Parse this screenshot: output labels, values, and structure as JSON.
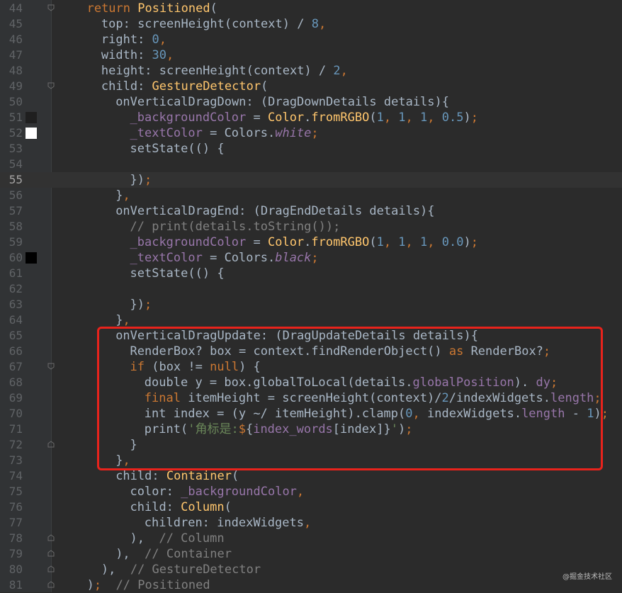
{
  "editor": {
    "first_line": 44,
    "current_line": 55,
    "colors": {
      "background": "#2b2b2b",
      "keyword": "#cc7832",
      "class": "#ffc66d",
      "number": "#6897bb",
      "comment": "#808080",
      "string": "#6a8759",
      "property": "#9876aa",
      "highlight_box": "#e8231c"
    },
    "lines": [
      {
        "n": "44",
        "indent": 2,
        "fold": "top",
        "tokens": [
          [
            "kw",
            "return "
          ],
          [
            "cls",
            "Positioned"
          ],
          [
            "pl",
            "("
          ]
        ]
      },
      {
        "n": "45",
        "indent": 3,
        "tokens": [
          [
            "pl",
            "top: screenHeight(context) / "
          ],
          [
            "num",
            "8"
          ],
          [
            "kw",
            ","
          ]
        ]
      },
      {
        "n": "46",
        "indent": 3,
        "tokens": [
          [
            "pl",
            "right: "
          ],
          [
            "num",
            "0"
          ],
          [
            "kw",
            ","
          ]
        ]
      },
      {
        "n": "47",
        "indent": 3,
        "tokens": [
          [
            "pl",
            "width: "
          ],
          [
            "num",
            "30"
          ],
          [
            "kw",
            ","
          ]
        ]
      },
      {
        "n": "48",
        "indent": 3,
        "tokens": [
          [
            "pl",
            "height: screenHeight(context) / "
          ],
          [
            "num",
            "2"
          ],
          [
            "kw",
            ","
          ]
        ]
      },
      {
        "n": "49",
        "indent": 3,
        "fold": "top",
        "tokens": [
          [
            "pl",
            "child: "
          ],
          [
            "cls",
            "GestureDetector"
          ],
          [
            "pl",
            "("
          ]
        ]
      },
      {
        "n": "50",
        "indent": 4,
        "tokens": [
          [
            "pl",
            "onVerticalDragDown: (DragDownDetails details){"
          ]
        ]
      },
      {
        "n": "51",
        "indent": 5,
        "swatch": "#1f1f1f",
        "tokens": [
          [
            "prop",
            "_backgroundColor"
          ],
          [
            "pl",
            " = "
          ],
          [
            "cls",
            "Color"
          ],
          [
            "pl",
            "."
          ],
          [
            "cls",
            "fromRGBO"
          ],
          [
            "pl",
            "("
          ],
          [
            "num",
            "1"
          ],
          [
            "kw",
            ", "
          ],
          [
            "num",
            "1"
          ],
          [
            "kw",
            ", "
          ],
          [
            "num",
            "1"
          ],
          [
            "kw",
            ", "
          ],
          [
            "num",
            "0.5"
          ],
          [
            "pl",
            ")"
          ],
          [
            "kw",
            ";"
          ]
        ]
      },
      {
        "n": "52",
        "indent": 5,
        "swatch": "#ffffff",
        "tokens": [
          [
            "prop",
            "_textColor"
          ],
          [
            "pl",
            " = Colors."
          ],
          [
            "ital",
            "white"
          ],
          [
            "kw",
            ";"
          ]
        ]
      },
      {
        "n": "53",
        "indent": 5,
        "tokens": [
          [
            "pl",
            "setState(() {"
          ]
        ]
      },
      {
        "n": "54",
        "indent": 0,
        "tokens": []
      },
      {
        "n": "55",
        "indent": 5,
        "tokens": [
          [
            "pl",
            "})"
          ],
          [
            "kw",
            ";"
          ]
        ]
      },
      {
        "n": "56",
        "indent": 4,
        "tokens": [
          [
            "pl",
            "}"
          ],
          [
            "kw",
            ","
          ]
        ]
      },
      {
        "n": "57",
        "indent": 4,
        "tokens": [
          [
            "pl",
            "onVerticalDragEnd: (DragEndDetails details){"
          ]
        ]
      },
      {
        "n": "58",
        "indent": 5,
        "tokens": [
          [
            "cmt",
            "// print(details.toString());"
          ]
        ]
      },
      {
        "n": "59",
        "indent": 5,
        "tokens": [
          [
            "prop",
            "_backgroundColor"
          ],
          [
            "pl",
            " = "
          ],
          [
            "cls",
            "Color"
          ],
          [
            "pl",
            "."
          ],
          [
            "cls",
            "fromRGBO"
          ],
          [
            "pl",
            "("
          ],
          [
            "num",
            "1"
          ],
          [
            "kw",
            ", "
          ],
          [
            "num",
            "1"
          ],
          [
            "kw",
            ", "
          ],
          [
            "num",
            "1"
          ],
          [
            "kw",
            ", "
          ],
          [
            "num",
            "0.0"
          ],
          [
            "pl",
            ")"
          ],
          [
            "kw",
            ";"
          ]
        ]
      },
      {
        "n": "60",
        "indent": 5,
        "swatch": "#000000",
        "tokens": [
          [
            "prop",
            "_textColor"
          ],
          [
            "pl",
            " = Colors."
          ],
          [
            "ital",
            "black"
          ],
          [
            "kw",
            ";"
          ]
        ]
      },
      {
        "n": "61",
        "indent": 5,
        "tokens": [
          [
            "pl",
            "setState(() {"
          ]
        ]
      },
      {
        "n": "62",
        "indent": 0,
        "tokens": []
      },
      {
        "n": "63",
        "indent": 5,
        "tokens": [
          [
            "pl",
            "})"
          ],
          [
            "kw",
            ";"
          ]
        ]
      },
      {
        "n": "64",
        "indent": 4,
        "tokens": [
          [
            "pl",
            "}"
          ],
          [
            "kw",
            ","
          ]
        ]
      },
      {
        "n": "65",
        "indent": 4,
        "tokens": [
          [
            "pl",
            "onVerticalDragUpdate: (DragUpdateDetails details){"
          ]
        ]
      },
      {
        "n": "66",
        "indent": 5,
        "tokens": [
          [
            "pl",
            "RenderBox? box = context.findRenderObject() "
          ],
          [
            "kw",
            "as"
          ],
          [
            "pl",
            " RenderBox?"
          ],
          [
            "kw",
            ";"
          ]
        ]
      },
      {
        "n": "67",
        "indent": 5,
        "fold": "top",
        "tokens": [
          [
            "kw",
            "if"
          ],
          [
            "pl",
            " (box != "
          ],
          [
            "kw",
            "null"
          ],
          [
            "pl",
            ") {"
          ]
        ]
      },
      {
        "n": "68",
        "indent": 6,
        "tokens": [
          [
            "pl",
            "double y = box.globalToLocal(details."
          ],
          [
            "prop",
            "globalPosition"
          ],
          [
            "pl",
            "). "
          ],
          [
            "prop",
            "dy"
          ],
          [
            "kw",
            ";"
          ]
        ]
      },
      {
        "n": "69",
        "indent": 6,
        "tokens": [
          [
            "kw",
            "final"
          ],
          [
            "pl",
            " itemHeight = screenHeight(context)/"
          ],
          [
            "num",
            "2"
          ],
          [
            "pl",
            "/indexWidgets."
          ],
          [
            "prop",
            "length"
          ],
          [
            "kw",
            ";"
          ]
        ]
      },
      {
        "n": "70",
        "indent": 6,
        "tokens": [
          [
            "pl",
            "int index = (y ~/ itemHeight).clamp("
          ],
          [
            "num",
            "0"
          ],
          [
            "kw",
            ", "
          ],
          [
            "pl",
            "indexWidgets."
          ],
          [
            "prop",
            "length"
          ],
          [
            "pl",
            " - "
          ],
          [
            "num",
            "1"
          ],
          [
            "pl",
            ")"
          ],
          [
            "kw",
            ";"
          ]
        ]
      },
      {
        "n": "71",
        "indent": 6,
        "tokens": [
          [
            "pl",
            "print("
          ],
          [
            "str",
            "'角标是:"
          ],
          [
            "kw",
            "$"
          ],
          [
            "pl",
            "{"
          ],
          [
            "prop",
            "index_words"
          ],
          [
            "pl",
            "[index]}"
          ],
          [
            "str",
            "'"
          ],
          [
            "pl",
            ")"
          ],
          [
            "kw",
            ";"
          ]
        ]
      },
      {
        "n": "72",
        "indent": 5,
        "fold": "bottom",
        "tokens": [
          [
            "pl",
            "}"
          ]
        ]
      },
      {
        "n": "73",
        "indent": 4,
        "tokens": [
          [
            "pl",
            "}"
          ],
          [
            "kw",
            ","
          ]
        ]
      },
      {
        "n": "74",
        "indent": 4,
        "tokens": [
          [
            "pl",
            "child: "
          ],
          [
            "cls",
            "Container"
          ],
          [
            "pl",
            "("
          ]
        ]
      },
      {
        "n": "75",
        "indent": 5,
        "tokens": [
          [
            "pl",
            "color: "
          ],
          [
            "prop",
            "_backgroundColor"
          ],
          [
            "kw",
            ","
          ]
        ]
      },
      {
        "n": "76",
        "indent": 5,
        "tokens": [
          [
            "pl",
            "child: "
          ],
          [
            "cls",
            "Column"
          ],
          [
            "pl",
            "("
          ]
        ]
      },
      {
        "n": "77",
        "indent": 6,
        "tokens": [
          [
            "pl",
            "children: indexWidgets"
          ],
          [
            "kw",
            ","
          ]
        ]
      },
      {
        "n": "78",
        "indent": 5,
        "fold": "bottom",
        "tokens": [
          [
            "pl",
            "), "
          ],
          [
            "cmt",
            " // Column"
          ]
        ]
      },
      {
        "n": "79",
        "indent": 4,
        "fold": "bottom",
        "tokens": [
          [
            "pl",
            "),"
          ],
          [
            "cmt",
            "  // Container"
          ]
        ]
      },
      {
        "n": "80",
        "indent": 3,
        "fold": "bottom",
        "tokens": [
          [
            "pl",
            "),"
          ],
          [
            "cmt",
            "  // GestureDetector"
          ]
        ]
      },
      {
        "n": "81",
        "indent": 2,
        "fold": "bottom",
        "tokens": [
          [
            "pl",
            ")"
          ],
          [
            "kw",
            ";"
          ],
          [
            "cmt",
            "  // Positioned"
          ]
        ]
      }
    ]
  },
  "watermark": "@掘金技术社区"
}
